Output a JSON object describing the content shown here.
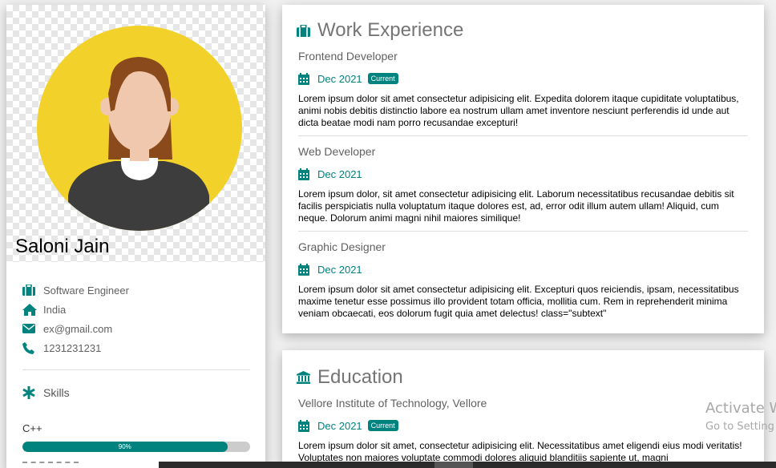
{
  "profile": {
    "name": "Saloni Jain",
    "details": [
      {
        "icon": "briefcase-icon",
        "text": "Software Engineer"
      },
      {
        "icon": "home-icon",
        "text": "India"
      },
      {
        "icon": "envelope-icon",
        "text": "ex@gmail.com"
      },
      {
        "icon": "phone-icon",
        "text": "1231231231"
      }
    ],
    "skills_heading": "Skills",
    "skills": [
      {
        "name": "C++",
        "level": 0.9,
        "label": "90%"
      }
    ]
  },
  "work": {
    "heading": "Work Experience",
    "entries": [
      {
        "title": "Frontend Developer",
        "date": "Dec 2021",
        "badge": "Current",
        "desc": "Lorem ipsum dolor sit amet consectetur adipisicing elit. Expedita dolorem itaque cupiditate voluptatibus, animi nobis debitis distinctio labore ea nostrum ullam amet inventore nesciunt perferendis id unde aut dicta beatae modi nam porro recusandae excepturi!"
      },
      {
        "title": "Web Developer",
        "date": "Dec 2021",
        "desc": "Lorem ipsum dolor, sit amet consectetur adipisicing elit. Laborum necessitatibus recusandae debitis sit facilis perspiciatis nulla voluptatum itaque dolores est, ad, error odit illum autem ullam! Aliquid, cum neque. Dolorum animi magni nihil maiores similique!"
      },
      {
        "title": "Graphic Designer",
        "date": "Dec 2021",
        "desc": "Lorem ipsum dolor sit amet consectetur adipisicing elit. Excepturi quos reiciendis, ipsam, necessitatibus maxime tenetur esse possimus illo provident totam officia, mollitia cum. Rem in reprehenderit minima veniam obcaecati, eos dolorum fugit quia amet delectus! class=\"subtext\""
      }
    ]
  },
  "education": {
    "heading": "Education",
    "entries": [
      {
        "title": "Vellore Institute of Technology, Vellore",
        "date": "Dec 2021",
        "badge": "Current",
        "desc": "Lorem ipsum dolor sit amet, consectetur adipisicing elit. Necessitatibus amet eligendi eius modi veritatis! Voluptates non maiores voluptate commodi dolores aliquid blanditiis sapiente ut, magni"
      }
    ]
  },
  "os_watermark": {
    "line1": "Activate W",
    "line2": "Go to Setting"
  },
  "colors": {
    "accent": "#00827f",
    "avatar_bg": "#f2d22a"
  }
}
